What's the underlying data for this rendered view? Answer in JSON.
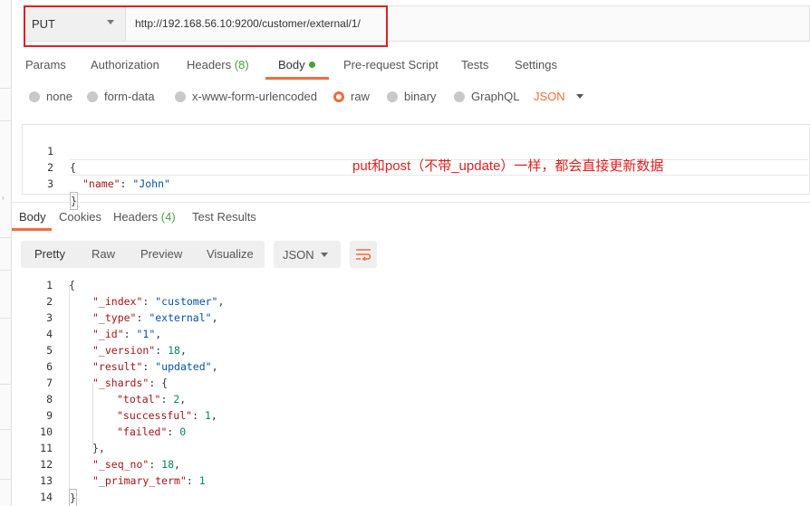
{
  "request": {
    "method": "PUT",
    "url": "http://192.168.56.10:9200/customer/external/1/"
  },
  "request_tabs": [
    {
      "label": "Params",
      "count": ""
    },
    {
      "label": "Authorization",
      "count": ""
    },
    {
      "label": "Headers",
      "count": "(8)"
    },
    {
      "label": "Body",
      "count": ""
    },
    {
      "label": "Pre-request Script",
      "count": ""
    },
    {
      "label": "Tests",
      "count": ""
    },
    {
      "label": "Settings",
      "count": ""
    }
  ],
  "active_request_tab": "Body",
  "body_types": [
    "none",
    "form-data",
    "x-www-form-urlencoded",
    "raw",
    "binary",
    "GraphQL"
  ],
  "selected_body_type": "raw",
  "raw_format": "JSON",
  "request_body": {
    "line_numbers": [
      "1",
      "2",
      "3"
    ],
    "line1": "{",
    "line2_key": "\"name\"",
    "line2_value": "\"John\"",
    "line3": "}"
  },
  "annotation": "put和post（不带_update）一样，都会直接更新数据",
  "response_tabs": [
    {
      "label": "Body",
      "count": ""
    },
    {
      "label": "Cookies",
      "count": ""
    },
    {
      "label": "Headers",
      "count": "(4)"
    },
    {
      "label": "Test Results",
      "count": ""
    }
  ],
  "view_modes": [
    "Pretty",
    "Raw",
    "Preview",
    "Visualize"
  ],
  "active_view_mode": "Pretty",
  "response_format": "JSON",
  "response_body": {
    "line_numbers": [
      "1",
      "2",
      "3",
      "4",
      "5",
      "6",
      "7",
      "8",
      "9",
      "10",
      "11",
      "12",
      "13",
      "14"
    ],
    "index_key": "\"_index\"",
    "index_value": "\"customer\"",
    "type_key": "\"_type\"",
    "type_value": "\"external\"",
    "id_key": "\"_id\"",
    "id_value": "\"1\"",
    "version_key": "\"_version\"",
    "version_value": "18",
    "result_key": "\"result\"",
    "result_value": "\"updated\"",
    "shards_key": "\"_shards\"",
    "total_key": "\"total\"",
    "total_value": "2",
    "successful_key": "\"successful\"",
    "successful_value": "1",
    "failed_key": "\"failed\"",
    "failed_value": "0",
    "seq_no_key": "\"_seq_no\"",
    "seq_no_value": "18",
    "primary_term_key": "\"_primary_term\"",
    "primary_term_value": "1"
  },
  "colors": {
    "accent": "#f26b3a",
    "count_green": "#4a9f3e",
    "annotation_red": "#e02020",
    "json_key": "#a31515",
    "json_string": "#0451a5",
    "json_number": "#098658"
  },
  "icons": {
    "wrap_lines": "wrap-lines-icon",
    "method_caret": "chevron-down-icon"
  }
}
